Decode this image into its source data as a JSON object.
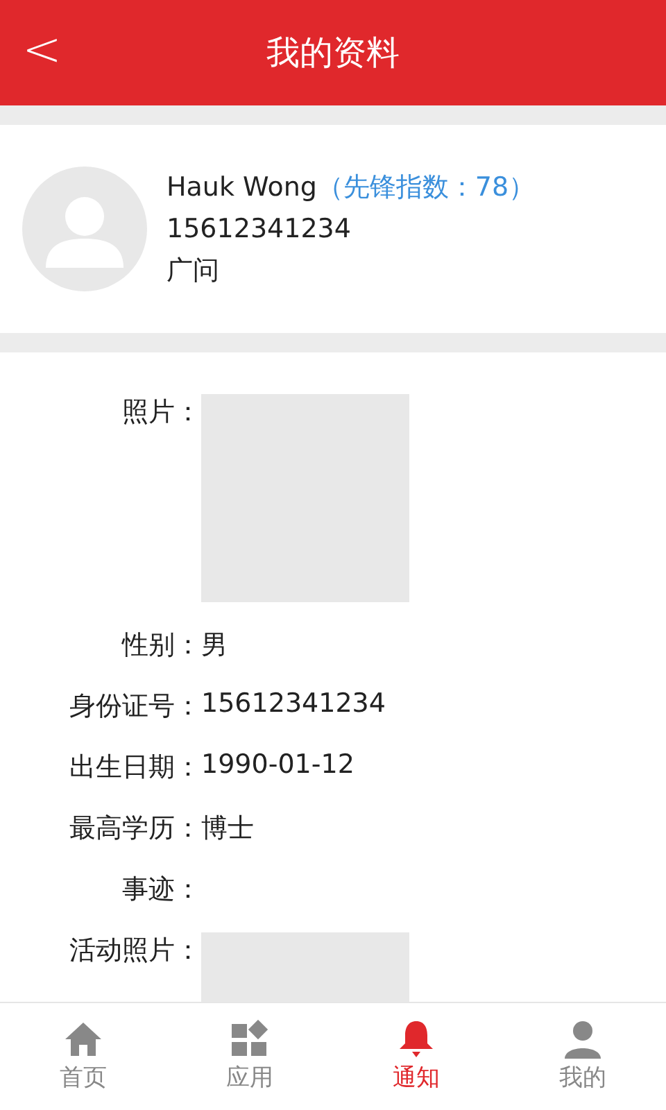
{
  "header": {
    "back": "<",
    "title": "我的资料"
  },
  "profile": {
    "name": "Hauk Wong",
    "score": "（先锋指数：78）",
    "phone": "15612341234",
    "role": "广问"
  },
  "fields": [
    {
      "kind": "photo",
      "label": "照片："
    },
    {
      "kind": "text",
      "label": "性别：",
      "value": "男"
    },
    {
      "kind": "text",
      "label": "身份证号：",
      "value": "15612341234"
    },
    {
      "kind": "text",
      "label": "出生日期：",
      "value": "1990-01-12"
    },
    {
      "kind": "text",
      "label": "最高学历：",
      "value": "博士"
    },
    {
      "kind": "text",
      "label": "事迹："
    },
    {
      "kind": "photo",
      "label": "活动照片："
    }
  ],
  "tabs": [
    {
      "label": "首页",
      "selected": false
    },
    {
      "label": "应用",
      "selected": false
    },
    {
      "label": "通知",
      "selected": true
    },
    {
      "label": "我的",
      "selected": false
    }
  ]
}
